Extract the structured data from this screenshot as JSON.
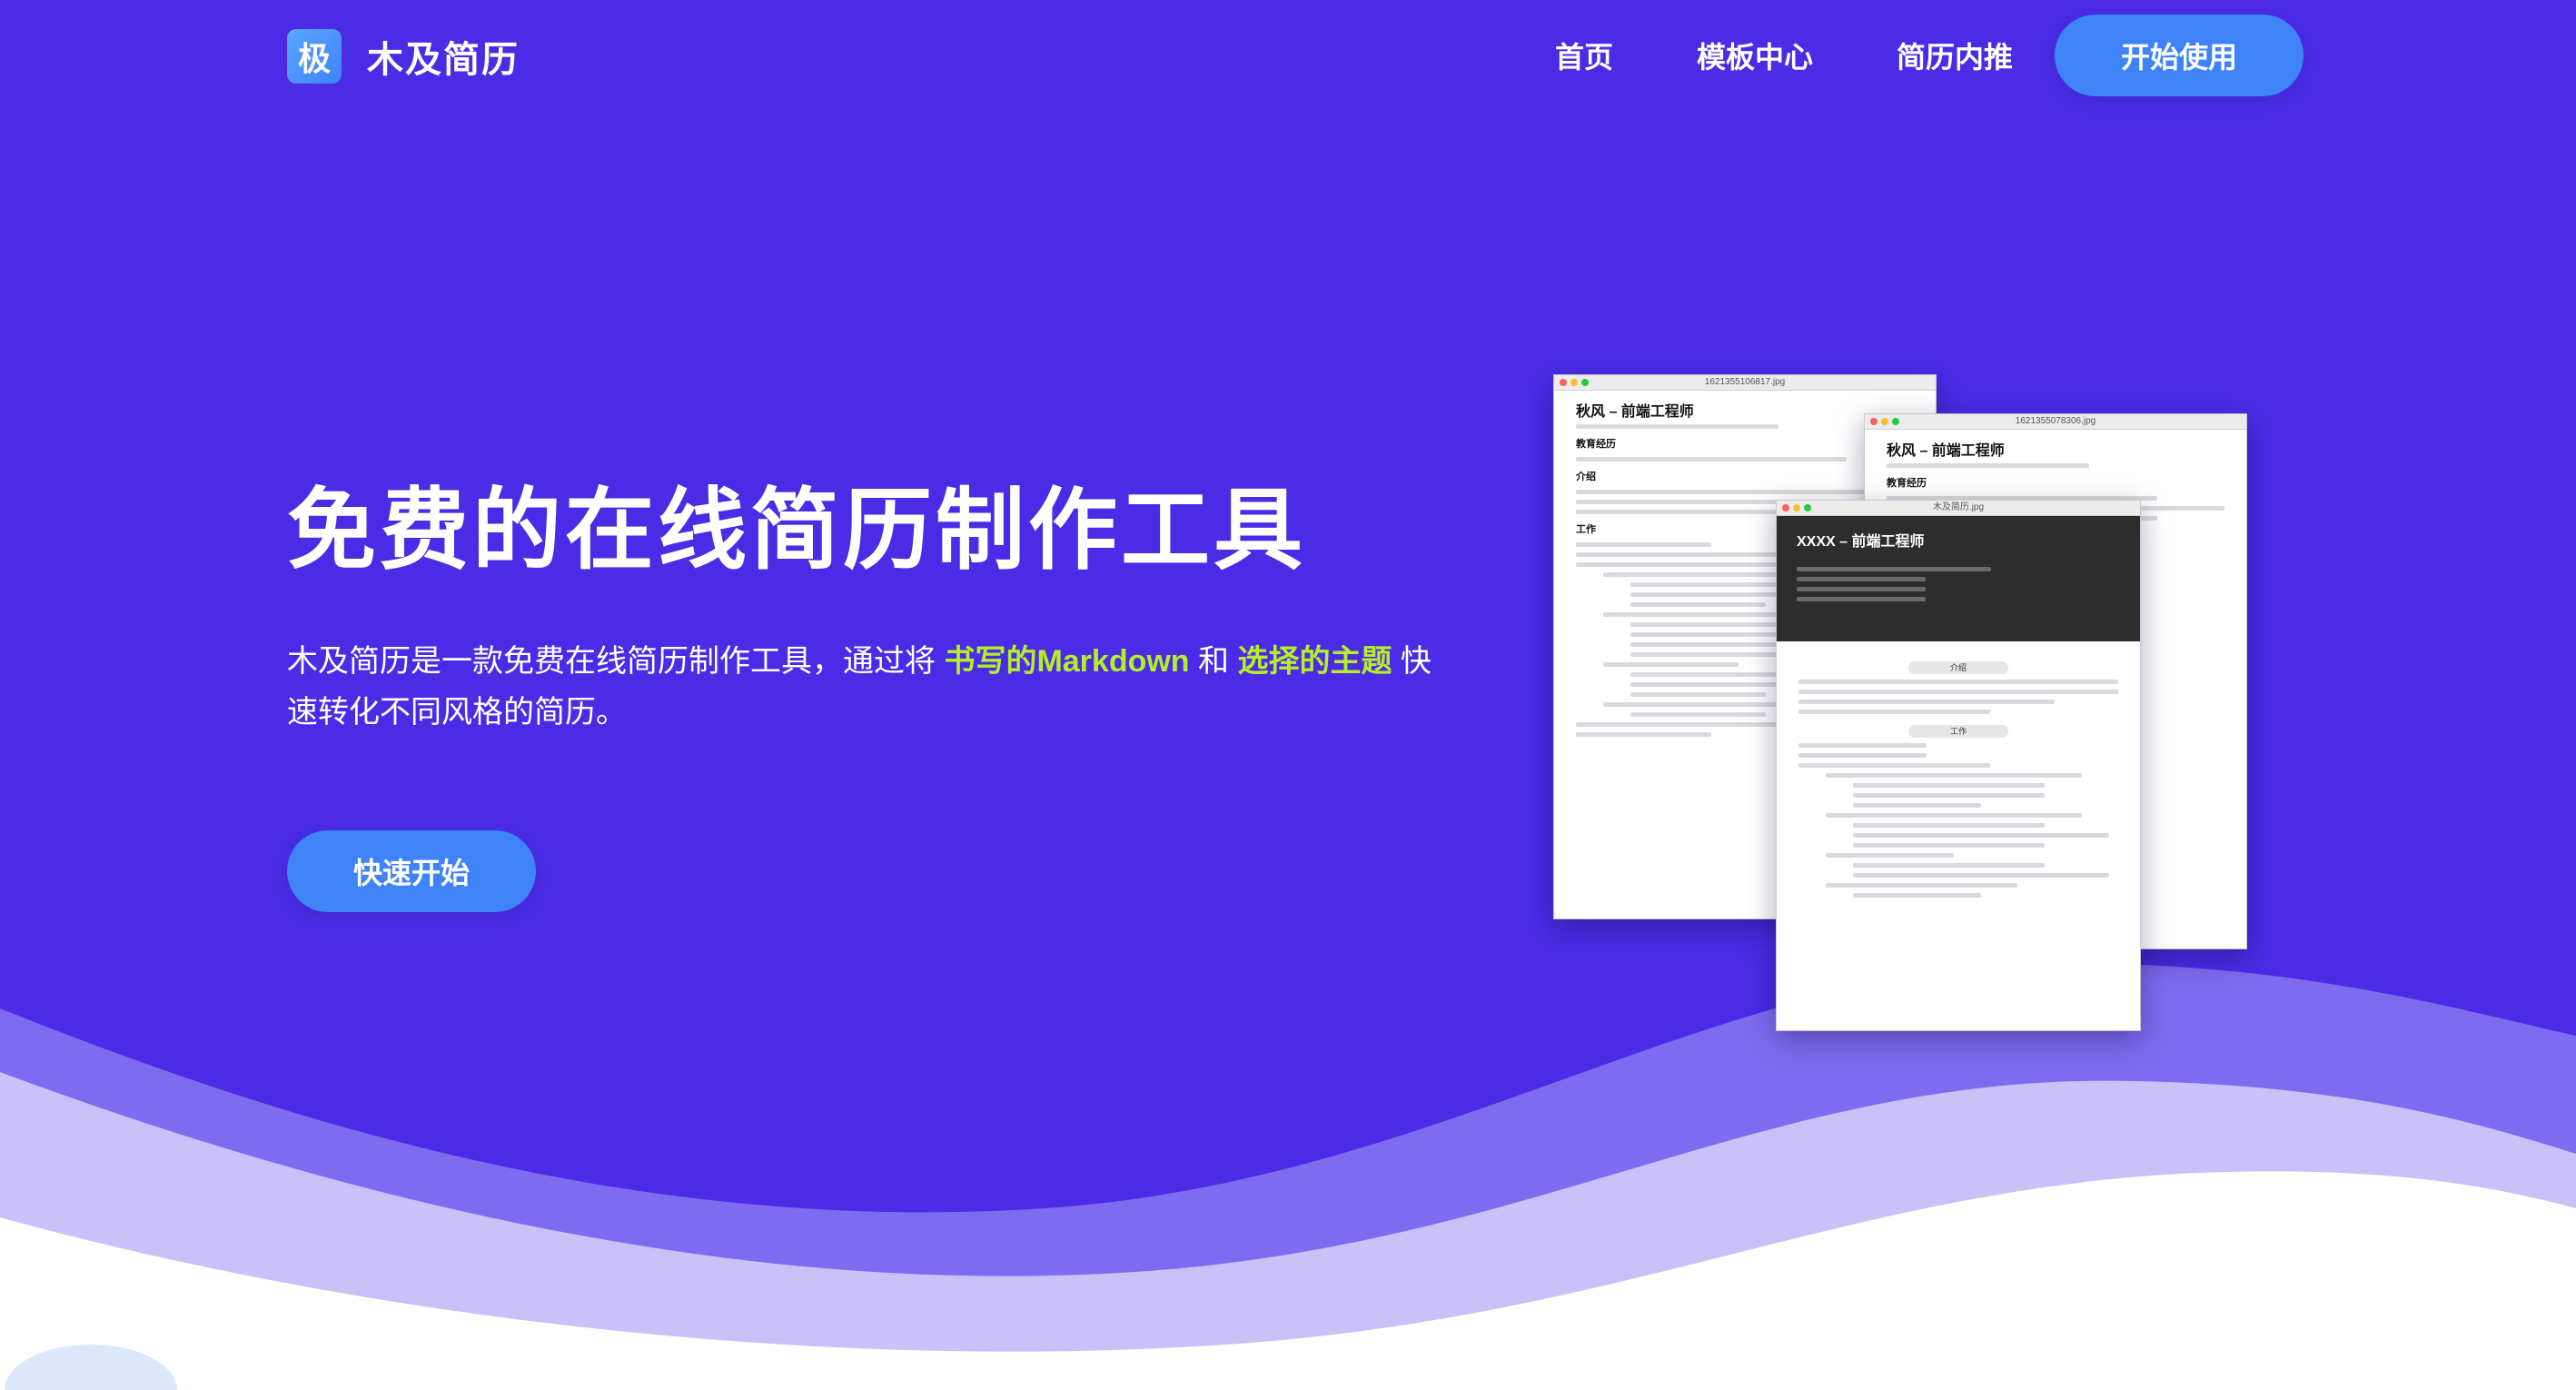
{
  "brand": {
    "logo_glyph": "极",
    "name": "木及简历"
  },
  "nav": {
    "links": [
      "首页",
      "模板中心",
      "简历内推"
    ],
    "cta": "开始使用"
  },
  "hero": {
    "title": "免费的在线简历制作工具",
    "desc_pre": "木及简历是一款免费在线简历制作工具，通过将 ",
    "desc_hl1": "书写的Markdown",
    "desc_mid": " 和 ",
    "desc_hl2": "选择的主题",
    "desc_post": " 快速转化不同风格的简历。",
    "button": "快速开始"
  },
  "previews": {
    "win1": {
      "filename": "1621355106817.jpg",
      "heading": "秋风 – 前端工程师",
      "sections": [
        "教育经历",
        "介绍",
        "工作"
      ]
    },
    "win2": {
      "filename": "1621355078306.jpg",
      "heading": "秋风 – 前端工程师",
      "sections": [
        "教育经历"
      ]
    },
    "win3": {
      "filename": "木及简历.jpg",
      "heading": "XXXX – 前端工程师",
      "pills": [
        "介绍",
        "工作"
      ]
    }
  },
  "colors": {
    "bg": "#4b2be6",
    "accent": "#3f83f8",
    "highlight": "#b5ee2a"
  }
}
